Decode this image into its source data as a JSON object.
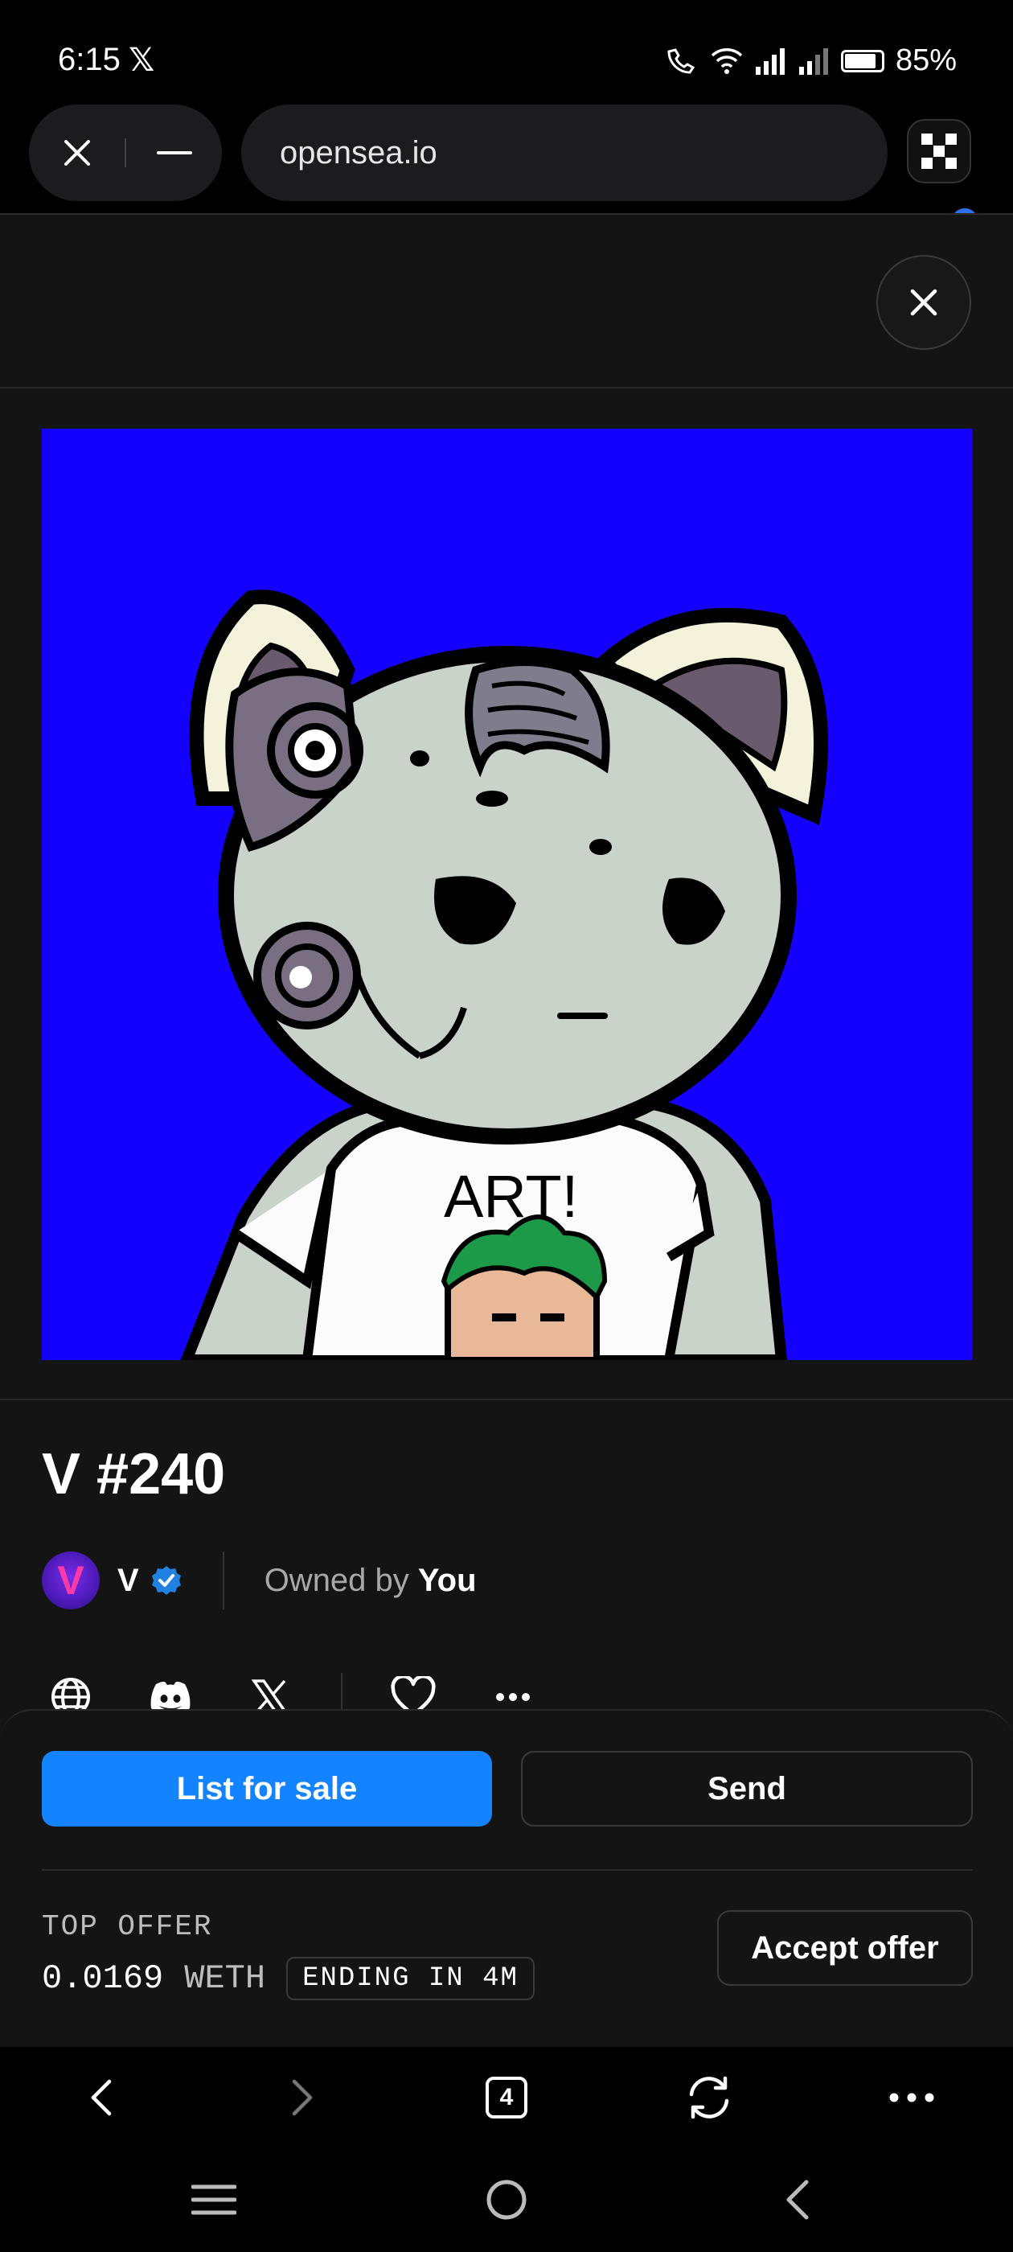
{
  "status_bar": {
    "time": "6:15",
    "app_icon": "x-icon",
    "battery": "85%"
  },
  "browser": {
    "url": "opensea.io",
    "tab_count": "4"
  },
  "nft": {
    "title": "V #240",
    "artwork_text": "ART!",
    "background_color": "#1400ff",
    "collection_name": "V",
    "collection_avatar_letter": "V",
    "owned_prefix": "Owned by",
    "owner": "You"
  },
  "actions": {
    "list_for_sale": "List for sale",
    "send": "Send",
    "accept_offer": "Accept offer"
  },
  "offer": {
    "label": "TOP OFFER",
    "amount": "0.0169",
    "currency": "WETH",
    "ending": "ENDING IN 4M"
  },
  "colors": {
    "accent": "#1383ff",
    "page_bg": "#141414",
    "verified": "#2081e2"
  }
}
